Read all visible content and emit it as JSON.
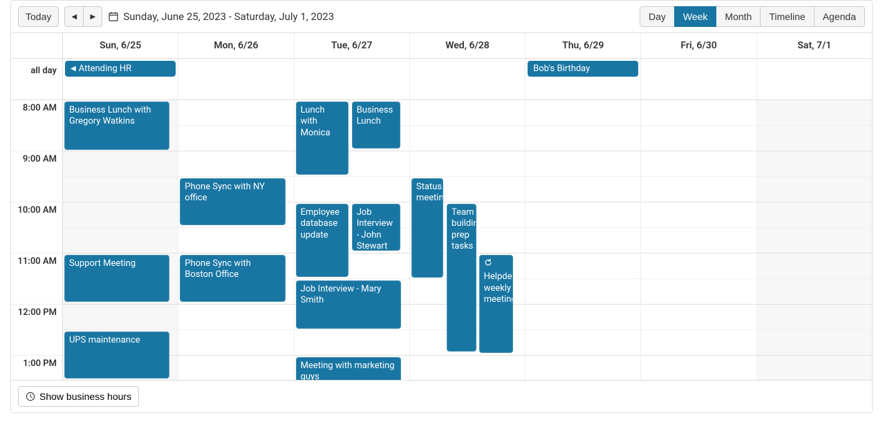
{
  "toolbar": {
    "today_label": "Today",
    "date_range": "Sunday, June 25, 2023 - Saturday, July 1, 2023",
    "views": {
      "day": "Day",
      "week": "Week",
      "month": "Month",
      "timeline": "Timeline",
      "agenda": "Agenda"
    },
    "active_view": "week"
  },
  "days": [
    {
      "label": "Sun, 6/25",
      "weekend": true
    },
    {
      "label": "Mon, 6/26",
      "weekend": false
    },
    {
      "label": "Tue, 6/27",
      "weekend": false
    },
    {
      "label": "Wed, 6/28",
      "weekend": false
    },
    {
      "label": "Thu, 6/29",
      "weekend": false
    },
    {
      "label": "Fri, 6/30",
      "weekend": false
    },
    {
      "label": "Sat, 7/1",
      "weekend": true
    }
  ],
  "all_day_label": "all day",
  "time_labels": [
    "8:00 AM",
    "9:00 AM",
    "10:00 AM",
    "11:00 AM",
    "12:00 PM",
    "1:00 PM"
  ],
  "all_day_events": {
    "sun": {
      "title": "Attending HR",
      "has_prev": true
    },
    "thu": {
      "title": "Bob's Birthday"
    }
  },
  "events": {
    "sun_lunch": "Business Lunch with Gregory Watkins",
    "sun_support": "Support Meeting",
    "sun_ups": "UPS maintenance",
    "mon_ny": "Phone Sync with NY office",
    "mon_boston": "Phone Sync with Boston Office",
    "tue_lunch_monica": "Lunch with Monica",
    "tue_biz_lunch": "Business Lunch",
    "tue_emp_db": "Employee database update",
    "tue_interview_john": "Job Interview - John Stewart",
    "tue_interview_mary": "Job Interview - Mary Smith",
    "tue_marketing": "Meeting with marketing guys",
    "wed_status": "Status meeting",
    "wed_team": "Team building prep tasks",
    "wed_helpdesk": "Helpdesk weekly meeting"
  },
  "footer": {
    "business_hours": "Show business hours"
  }
}
